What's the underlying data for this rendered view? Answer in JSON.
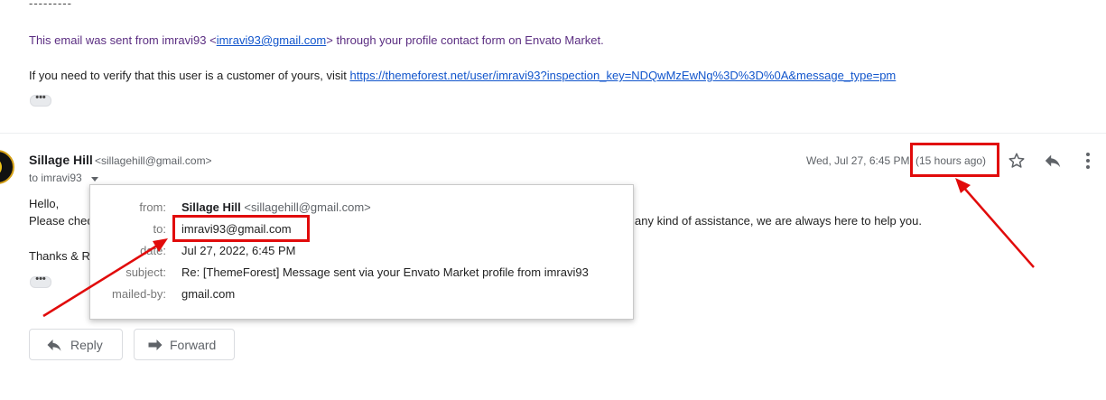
{
  "previous_message": {
    "dashes": "---------",
    "sent_prefix": "This email was sent from imravi93 <",
    "sent_email": "imravi93@gmail.com",
    "sent_suffix": "> through your profile contact form on Envato Market.",
    "verify_prefix": "If you need to verify that this user is a customer of yours, visit ",
    "verify_link": "https://themeforest.net/user/imravi93?inspection_key=NDQwMzEwNg%3D%3D%0A&message_type=pm",
    "more_dots": "•••"
  },
  "message": {
    "sender_name": "Sillage Hill",
    "sender_email": "<sillagehill@gmail.com>",
    "to_line": "to imravi93",
    "date": "Wed, Jul 27, 6:45 PM",
    "ago": "(15 hours ago)",
    "body_hello": "Hello,",
    "body_please": "Please chec",
    "body_rest": "any kind of assistance, we are always here to help you.",
    "body_thanks": "Thanks & R",
    "more_dots": "•••"
  },
  "details": {
    "from_label": "from:",
    "from_name": "Sillage Hill",
    "from_email": "<sillagehill@gmail.com>",
    "to_label": "to:",
    "to_value": "imravi93@gmail.com",
    "date_label": "date:",
    "date_value": "Jul 27, 2022, 6:45 PM",
    "subject_label": "subject:",
    "subject_value": "Re: [ThemeForest] Message sent via your Envato Market profile from imravi93",
    "mailedby_label": "mailed-by:",
    "mailedby_value": "gmail.com"
  },
  "actions": {
    "reply_label": "Reply",
    "forward_label": "Forward"
  },
  "icons": {
    "star": "star-icon",
    "reply": "reply-icon",
    "more": "more-vert-icon",
    "to_caret": "caret-down-icon"
  },
  "colors": {
    "annotation_red": "#e10b0b",
    "link_blue": "#1155cc",
    "envato_purple": "#5b2e82"
  }
}
